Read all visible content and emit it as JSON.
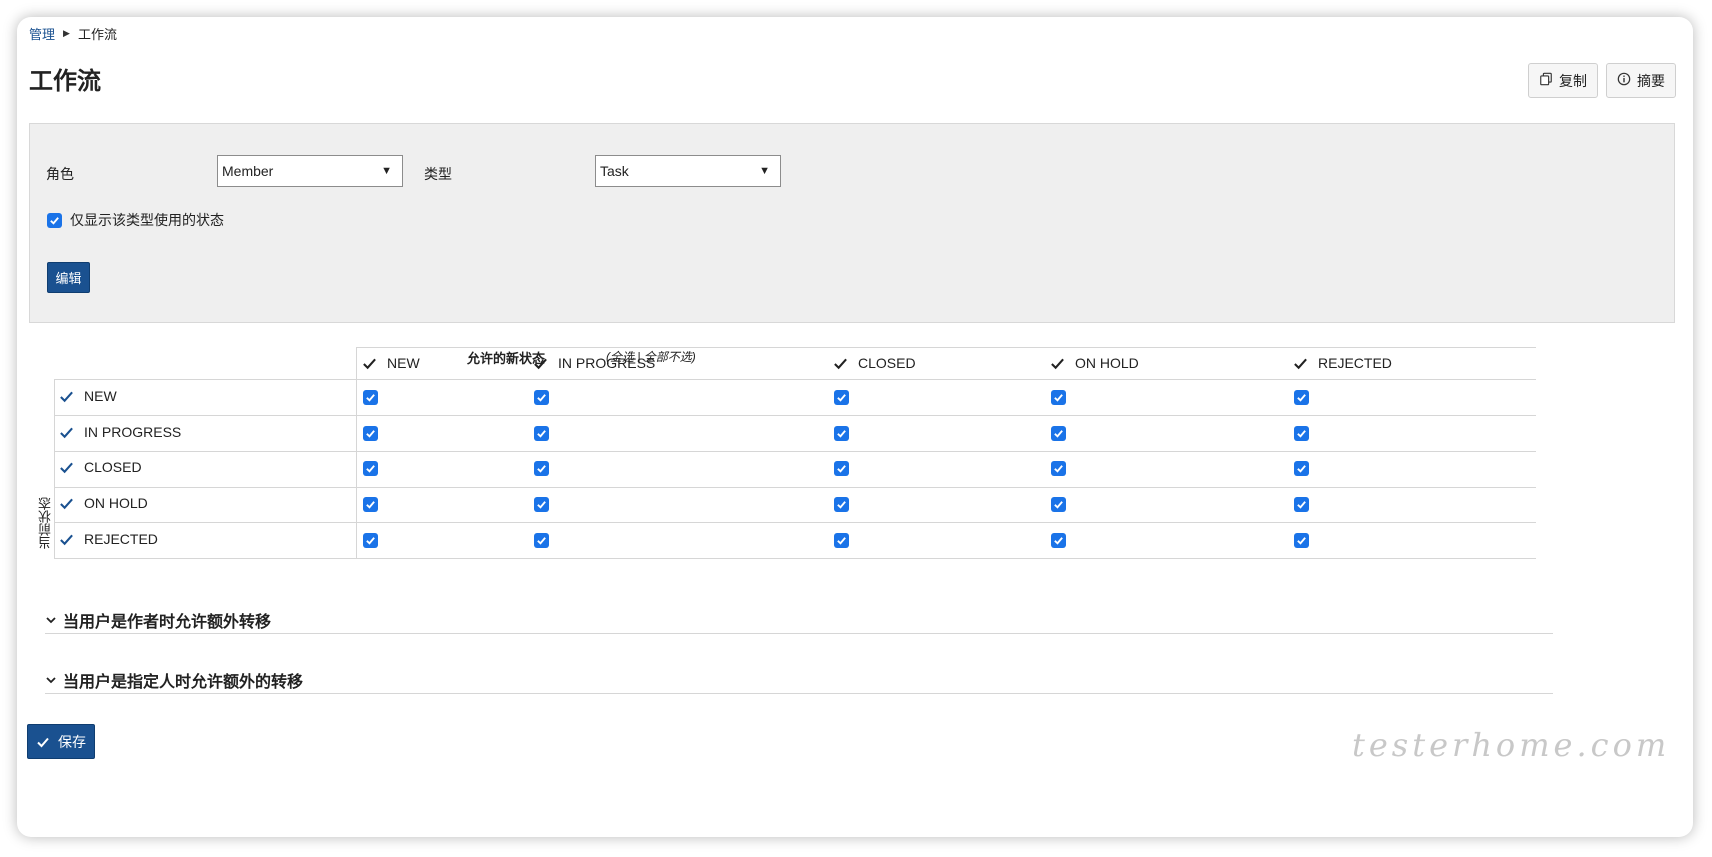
{
  "breadcrumb": {
    "parent": "管理",
    "current": "工作流"
  },
  "page_title": "工作流",
  "actions": {
    "copy_label": "复制",
    "summary_label": "摘要"
  },
  "filters": {
    "role_label": "角色",
    "role_value": "Member",
    "type_label": "类型",
    "type_value": "Task",
    "only_used_label": "仅显示该类型使用的状态",
    "only_used_checked": true,
    "edit_label": "编辑"
  },
  "matrix": {
    "allowed_title": "允许的新状态",
    "select_all": "(全选",
    "select_none": "| 全部不选)",
    "current_status_label": "当前状态",
    "columns": [
      "NEW",
      "IN PROGRESS",
      "CLOSED",
      "ON HOLD",
      "REJECTED"
    ],
    "rows": [
      {
        "label": "NEW",
        "checked": [
          true,
          true,
          true,
          true,
          true
        ]
      },
      {
        "label": "IN PROGRESS",
        "checked": [
          true,
          true,
          true,
          true,
          true
        ]
      },
      {
        "label": "CLOSED",
        "checked": [
          true,
          true,
          true,
          true,
          true
        ]
      },
      {
        "label": "ON HOLD",
        "checked": [
          true,
          true,
          true,
          true,
          true
        ]
      },
      {
        "label": "REJECTED",
        "checked": [
          true,
          true,
          true,
          true,
          true
        ]
      }
    ]
  },
  "sections": {
    "author_label": "当用户是作者时允许额外转移",
    "assignee_label": "当用户是指定人时允许额外的转移"
  },
  "save_label": "保存",
  "watermark": "testerhome.com",
  "colors": {
    "primary": "#1a5190",
    "checkbox": "#1a73e8",
    "panel_bg": "#efefef"
  },
  "icons": {
    "copy": "copy-icon",
    "summary": "info-icon",
    "check": "check-icon",
    "chevron": "chevron-down-icon"
  }
}
